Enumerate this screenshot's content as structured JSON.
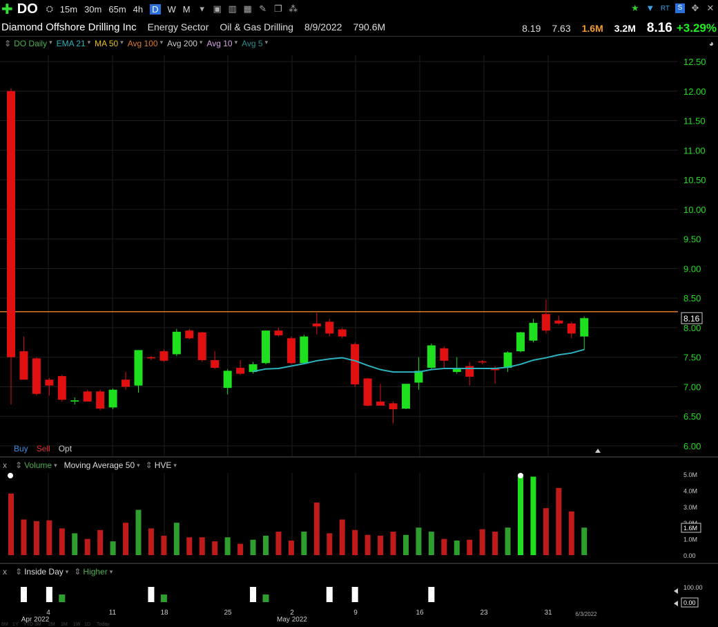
{
  "toolbar": {
    "symbol": "DO",
    "timeframes": [
      "15m",
      "30m",
      "65m",
      "4h",
      "D",
      "W",
      "M"
    ],
    "selected": "D",
    "rt_label": "RT"
  },
  "info": {
    "company": "Diamond Offshore Drilling Inc",
    "sector": "Energy Sector",
    "industry": "Oil & Gas Drilling",
    "date": "8/9/2022",
    "market_cap": "790.6M",
    "high": "8.19",
    "low": "7.63",
    "volume": "1.6M",
    "avg_volume": "3.2M",
    "last": "8.16",
    "change": "+3.29%"
  },
  "studies": [
    {
      "label": "DO Daily",
      "color": "#4caf50"
    },
    {
      "label": "EMA 21",
      "color": "#2bb3c0"
    },
    {
      "label": "MA 50",
      "color": "#e6c229"
    },
    {
      "label": "Avg 100",
      "color": "#e07b2a"
    },
    {
      "label": "Avg 200",
      "color": "#cccccc"
    },
    {
      "label": "Avg 10",
      "color": "#d6a6e6"
    },
    {
      "label": "Avg 5",
      "color": "#2a8a8a"
    }
  ],
  "trade": {
    "buy": "Buy",
    "sell": "Sell",
    "opt": "Opt"
  },
  "volume_pane": {
    "x": "x",
    "label": "Volume",
    "ma": "Moving Average 50",
    "hve": "HVE",
    "current": "1.6M"
  },
  "inside_pane": {
    "x": "x",
    "label": "Inside Day",
    "higher": "Higher",
    "current": "0.00"
  },
  "colors": {
    "up": "#1fe01f",
    "down": "#e01010",
    "volup": "#2e9e2e",
    "voldown": "#c01a1a",
    "ema": "#2bb3c0",
    "hline": "#e07b2a"
  },
  "chart_data": {
    "type": "candlestick",
    "price_ylim": [
      6.0,
      12.5
    ],
    "price_ticks": [
      "12.50",
      "12.00",
      "11.50",
      "11.00",
      "10.50",
      "10.00",
      "9.50",
      "9.00",
      "8.50",
      "8.00",
      "7.50",
      "7.00",
      "6.50",
      "6.00"
    ],
    "last_price": "8.16",
    "horizontal_line": 8.27,
    "x_ticks": [
      "4",
      "11",
      "18",
      "25",
      "2",
      "9",
      "16",
      "23",
      "31"
    ],
    "month_labels": [
      "Apr 2022",
      "May 2022"
    ],
    "end_date": "6/3/2022",
    "bottom_tabs": [
      "6M",
      "1Y",
      "YTD",
      "3M",
      "2M",
      "1M",
      "1W",
      "1D",
      "Today"
    ],
    "candles": [
      {
        "o": 12.0,
        "h": 12.05,
        "l": 6.7,
        "c": 7.5
      },
      {
        "o": 7.6,
        "h": 7.85,
        "l": 7.15,
        "c": 7.12
      },
      {
        "o": 7.48,
        "h": 7.5,
        "l": 6.85,
        "c": 6.88
      },
      {
        "o": 7.12,
        "h": 7.15,
        "l": 6.85,
        "c": 7.02
      },
      {
        "o": 7.18,
        "h": 7.2,
        "l": 6.75,
        "c": 6.78
      },
      {
        "o": 6.75,
        "h": 6.82,
        "l": 6.7,
        "c": 6.77
      },
      {
        "o": 6.92,
        "h": 6.95,
        "l": 6.75,
        "c": 6.75
      },
      {
        "o": 6.92,
        "h": 6.95,
        "l": 6.6,
        "c": 6.63
      },
      {
        "o": 6.65,
        "h": 6.97,
        "l": 6.62,
        "c": 6.95
      },
      {
        "o": 7.12,
        "h": 7.25,
        "l": 6.95,
        "c": 7.0
      },
      {
        "o": 7.02,
        "h": 7.62,
        "l": 6.9,
        "c": 7.62
      },
      {
        "o": 7.5,
        "h": 7.52,
        "l": 7.45,
        "c": 7.48
      },
      {
        "o": 7.6,
        "h": 7.63,
        "l": 7.42,
        "c": 7.44
      },
      {
        "o": 7.55,
        "h": 7.98,
        "l": 7.52,
        "c": 7.93
      },
      {
        "o": 7.95,
        "h": 7.98,
        "l": 7.8,
        "c": 7.82
      },
      {
        "o": 7.92,
        "h": 7.93,
        "l": 7.42,
        "c": 7.45
      },
      {
        "o": 7.45,
        "h": 7.6,
        "l": 7.3,
        "c": 7.32
      },
      {
        "o": 6.98,
        "h": 7.3,
        "l": 6.87,
        "c": 7.27
      },
      {
        "o": 7.32,
        "h": 7.45,
        "l": 7.2,
        "c": 7.22
      },
      {
        "o": 7.25,
        "h": 7.42,
        "l": 7.22,
        "c": 7.38
      },
      {
        "o": 7.4,
        "h": 7.95,
        "l": 7.38,
        "c": 7.95
      },
      {
        "o": 7.95,
        "h": 8.0,
        "l": 7.85,
        "c": 7.87
      },
      {
        "o": 7.82,
        "h": 7.85,
        "l": 7.38,
        "c": 7.4
      },
      {
        "o": 7.4,
        "h": 7.88,
        "l": 7.38,
        "c": 7.85
      },
      {
        "o": 8.07,
        "h": 8.25,
        "l": 7.88,
        "c": 8.02
      },
      {
        "o": 8.1,
        "h": 8.15,
        "l": 7.85,
        "c": 7.9
      },
      {
        "o": 7.97,
        "h": 8.0,
        "l": 7.82,
        "c": 7.85
      },
      {
        "o": 7.72,
        "h": 7.75,
        "l": 7.0,
        "c": 7.04
      },
      {
        "o": 7.14,
        "h": 7.15,
        "l": 6.67,
        "c": 6.68
      },
      {
        "o": 6.75,
        "h": 7.05,
        "l": 6.7,
        "c": 6.68
      },
      {
        "o": 6.72,
        "h": 6.75,
        "l": 6.38,
        "c": 6.62
      },
      {
        "o": 6.63,
        "h": 7.05,
        "l": 6.62,
        "c": 7.05
      },
      {
        "o": 7.07,
        "h": 7.5,
        "l": 6.95,
        "c": 7.27
      },
      {
        "o": 7.32,
        "h": 7.73,
        "l": 7.3,
        "c": 7.7
      },
      {
        "o": 7.65,
        "h": 7.68,
        "l": 7.3,
        "c": 7.44
      },
      {
        "o": 7.25,
        "h": 7.5,
        "l": 7.22,
        "c": 7.3
      },
      {
        "o": 7.35,
        "h": 7.42,
        "l": 7.02,
        "c": 7.17
      },
      {
        "o": 7.43,
        "h": 7.45,
        "l": 7.38,
        "c": 7.41
      },
      {
        "o": 7.32,
        "h": 7.35,
        "l": 7.05,
        "c": 7.28
      },
      {
        "o": 7.32,
        "h": 7.6,
        "l": 7.25,
        "c": 7.58
      },
      {
        "o": 7.6,
        "h": 7.93,
        "l": 7.58,
        "c": 7.92
      },
      {
        "o": 7.78,
        "h": 8.15,
        "l": 7.75,
        "c": 8.08
      },
      {
        "o": 8.23,
        "h": 8.47,
        "l": 7.9,
        "c": 7.95
      },
      {
        "o": 8.12,
        "h": 8.2,
        "l": 8.05,
        "c": 8.07
      },
      {
        "o": 8.07,
        "h": 8.1,
        "l": 7.82,
        "c": 7.9
      },
      {
        "o": 7.85,
        "h": 8.19,
        "l": 7.63,
        "c": 8.16
      }
    ],
    "ema": [
      null,
      null,
      null,
      null,
      null,
      null,
      null,
      null,
      null,
      null,
      null,
      null,
      null,
      null,
      null,
      null,
      null,
      null,
      null,
      7.26,
      7.3,
      7.31,
      7.35,
      7.39,
      7.44,
      7.47,
      7.49,
      7.44,
      7.36,
      7.29,
      7.25,
      7.25,
      7.25,
      7.29,
      7.31,
      7.31,
      7.31,
      7.31,
      7.31,
      7.33,
      7.38,
      7.45,
      7.49,
      7.54,
      7.57,
      7.63
    ],
    "volume_ylim": [
      0,
      5.0
    ],
    "volume_ticks": [
      "5.0M",
      "4.0M",
      "3.0M",
      "2.0M",
      "1.0M",
      "0.00"
    ],
    "volume": [
      3.8,
      2.2,
      2.1,
      2.15,
      1.65,
      1.35,
      1.0,
      1.55,
      0.85,
      2.0,
      2.8,
      1.65,
      1.2,
      2.0,
      1.1,
      1.1,
      0.85,
      1.1,
      0.7,
      0.95,
      1.2,
      1.45,
      0.9,
      1.45,
      3.25,
      1.35,
      2.2,
      1.55,
      1.25,
      1.2,
      1.45,
      1.25,
      1.7,
      1.45,
      1.0,
      0.9,
      0.95,
      1.6,
      1.45,
      1.7,
      5.0,
      4.85,
      2.9,
      4.15,
      2.7,
      1.7
    ],
    "inside_ylim": [
      0,
      100
    ],
    "inside_ticks": [
      "100.00",
      "0.00"
    ],
    "inside": [
      null,
      100,
      null,
      100,
      50,
      null,
      null,
      null,
      null,
      null,
      null,
      100,
      50,
      null,
      null,
      null,
      null,
      null,
      null,
      100,
      50,
      null,
      null,
      null,
      null,
      100,
      null,
      100,
      null,
      null,
      null,
      null,
      null,
      100,
      null,
      null,
      null,
      null,
      null,
      null,
      null,
      null,
      null,
      null,
      null,
      null
    ]
  }
}
